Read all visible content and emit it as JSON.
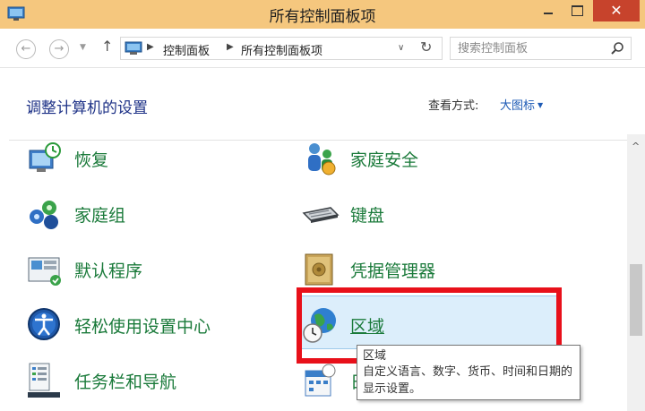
{
  "window": {
    "title": "所有控制面板项",
    "close_glyph": "✕"
  },
  "navigation": {
    "back_glyph": "←",
    "forward_glyph": "→",
    "recent_glyph": "▼",
    "up_glyph": "↑",
    "breadcrumbs": [
      "控制面板",
      "所有控制面板项"
    ],
    "breadcrumb_sep": "▶",
    "dropdown_glyph": "∨",
    "refresh_glyph": "↻",
    "search_placeholder": "搜索控制面板"
  },
  "header": {
    "title": "调整计算机的设置",
    "view_label": "查看方式:",
    "view_value": "大图标"
  },
  "items": {
    "recovery": "恢复",
    "family_safety": "家庭安全",
    "homegroup": "家庭组",
    "keyboard": "键盘",
    "default_programs": "默认程序",
    "credential_manager": "凭据管理器",
    "ease_of_access": "轻松使用设置中心",
    "region": "区域",
    "taskbar": "任务栏和导航",
    "date_partial": "日"
  },
  "tooltip": {
    "title": "区域",
    "description": "自定义语言、数字、货币、时间和日期的显示设置。"
  },
  "scrollbar": {
    "up_glyph": "^"
  },
  "colors": {
    "titlebar": "#f5c77e",
    "close_button": "#c7432c",
    "link_green": "#1a7a3a",
    "title_blue": "#1e3287",
    "highlight_red": "#e8101a"
  }
}
